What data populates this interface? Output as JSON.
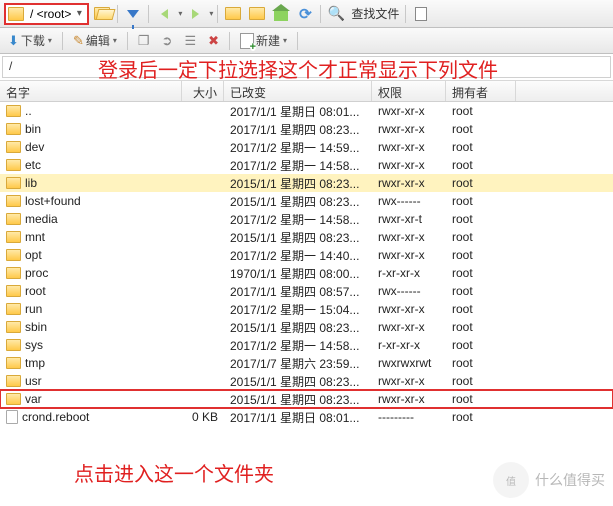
{
  "toolbar": {
    "path_combo": "/ <root>",
    "find_files": "查找文件"
  },
  "toolbar2": {
    "download": "下载",
    "edit": "编辑",
    "new": "新建"
  },
  "overlays": {
    "line1": "登录后一定下拉选择这个才正常显示下列文件",
    "line2": "点击进入这一个文件夹"
  },
  "pathbar": "/",
  "columns": {
    "name": "名字",
    "size": "大小",
    "changed": "已改变",
    "perm": "权限",
    "owner": "拥有者"
  },
  "rows": [
    {
      "icon": "up",
      "name": "..",
      "size": "",
      "changed": "2017/1/1 星期日 08:01...",
      "perm": "rwxr-xr-x",
      "owner": "root"
    },
    {
      "icon": "folder",
      "name": "bin",
      "size": "",
      "changed": "2017/1/1 星期四 08:23...",
      "perm": "rwxr-xr-x",
      "owner": "root"
    },
    {
      "icon": "folder",
      "name": "dev",
      "size": "",
      "changed": "2017/1/2 星期一 14:59...",
      "perm": "rwxr-xr-x",
      "owner": "root"
    },
    {
      "icon": "folder",
      "name": "etc",
      "size": "",
      "changed": "2017/1/2 星期一 14:58...",
      "perm": "rwxr-xr-x",
      "owner": "root"
    },
    {
      "icon": "folder",
      "name": "lib",
      "size": "",
      "changed": "2015/1/1 星期四 08:23...",
      "perm": "rwxr-xr-x",
      "owner": "root",
      "sel": true
    },
    {
      "icon": "folder",
      "name": "lost+found",
      "size": "",
      "changed": "2015/1/1 星期四 08:23...",
      "perm": "rwx------",
      "owner": "root"
    },
    {
      "icon": "folder",
      "name": "media",
      "size": "",
      "changed": "2017/1/2 星期一 14:58...",
      "perm": "rwxr-xr-t",
      "owner": "root"
    },
    {
      "icon": "folder",
      "name": "mnt",
      "size": "",
      "changed": "2015/1/1 星期四 08:23...",
      "perm": "rwxr-xr-x",
      "owner": "root"
    },
    {
      "icon": "folder",
      "name": "opt",
      "size": "",
      "changed": "2017/1/2 星期一 14:40...",
      "perm": "rwxr-xr-x",
      "owner": "root"
    },
    {
      "icon": "folder",
      "name": "proc",
      "size": "",
      "changed": "1970/1/1 星期四 08:00...",
      "perm": "r-xr-xr-x",
      "owner": "root"
    },
    {
      "icon": "folder",
      "name": "root",
      "size": "",
      "changed": "2017/1/1 星期四 08:57...",
      "perm": "rwx------",
      "owner": "root"
    },
    {
      "icon": "folder",
      "name": "run",
      "size": "",
      "changed": "2017/1/2 星期一 15:04...",
      "perm": "rwxr-xr-x",
      "owner": "root"
    },
    {
      "icon": "folder",
      "name": "sbin",
      "size": "",
      "changed": "2015/1/1 星期四 08:23...",
      "perm": "rwxr-xr-x",
      "owner": "root"
    },
    {
      "icon": "folder",
      "name": "sys",
      "size": "",
      "changed": "2017/1/2 星期一 14:58...",
      "perm": "r-xr-xr-x",
      "owner": "root"
    },
    {
      "icon": "folder",
      "name": "tmp",
      "size": "",
      "changed": "2017/1/7 星期六 23:59...",
      "perm": "rwxrwxrwt",
      "owner": "root"
    },
    {
      "icon": "folder",
      "name": "usr",
      "size": "",
      "changed": "2015/1/1 星期四 08:23...",
      "perm": "rwxr-xr-x",
      "owner": "root"
    },
    {
      "icon": "folder",
      "name": "var",
      "size": "",
      "changed": "2015/1/1 星期四 08:23...",
      "perm": "rwxr-xr-x",
      "owner": "root",
      "hilite": true
    },
    {
      "icon": "doc",
      "name": "crond.reboot",
      "size": "0 KB",
      "changed": "2017/1/1 星期日 08:01...",
      "perm": "---------",
      "owner": "root"
    }
  ],
  "watermark": {
    "logo": "值",
    "text": "什么值得买"
  }
}
